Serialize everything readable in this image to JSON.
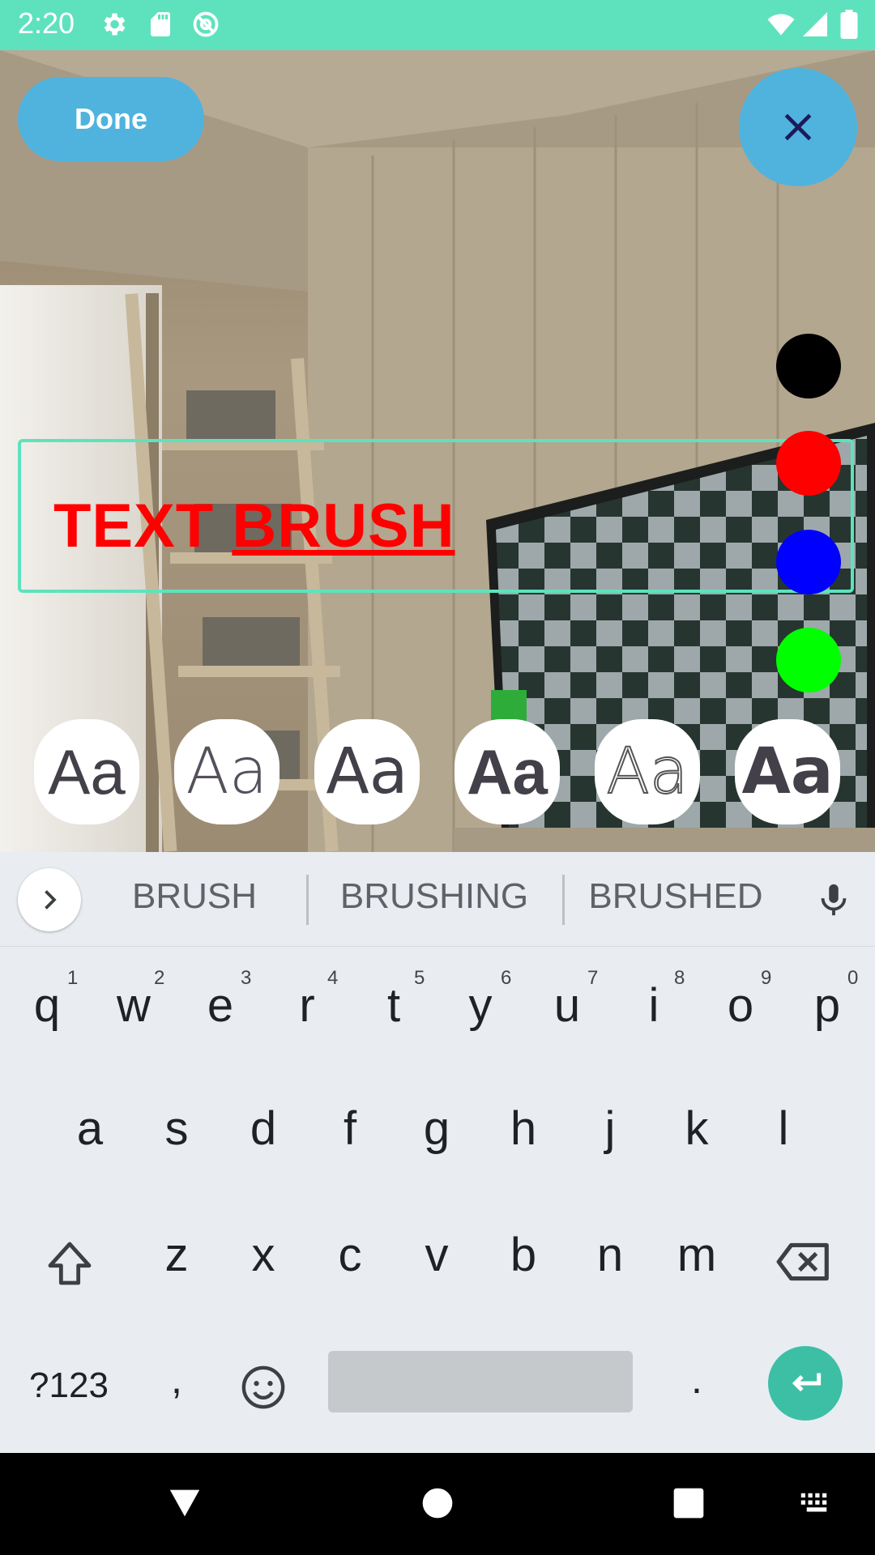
{
  "status": {
    "time": "2:20"
  },
  "editor": {
    "done_label": "Done",
    "text_word1": "TEXT ",
    "text_word2": "BRUSH",
    "colors": [
      "#000000",
      "#ff0000",
      "#0000ff",
      "#00ff00"
    ],
    "font_samples": [
      "Aa",
      "Aa",
      "Aa",
      "Aa",
      "Aa",
      "Aa"
    ]
  },
  "keyboard": {
    "suggestions": [
      "BRUSH",
      "BRUSHING",
      "BRUSHED"
    ],
    "row1": [
      "q",
      "w",
      "e",
      "r",
      "t",
      "y",
      "u",
      "i",
      "o",
      "p"
    ],
    "row1_hints": [
      "1",
      "2",
      "3",
      "4",
      "5",
      "6",
      "7",
      "8",
      "9",
      "0"
    ],
    "row2": [
      "a",
      "s",
      "d",
      "f",
      "g",
      "h",
      "j",
      "k",
      "l"
    ],
    "row3": [
      "z",
      "x",
      "c",
      "v",
      "b",
      "n",
      "m"
    ],
    "symbols_label": "?123",
    "comma": ",",
    "period": ".",
    "accent_color": "#3dbfa5"
  }
}
